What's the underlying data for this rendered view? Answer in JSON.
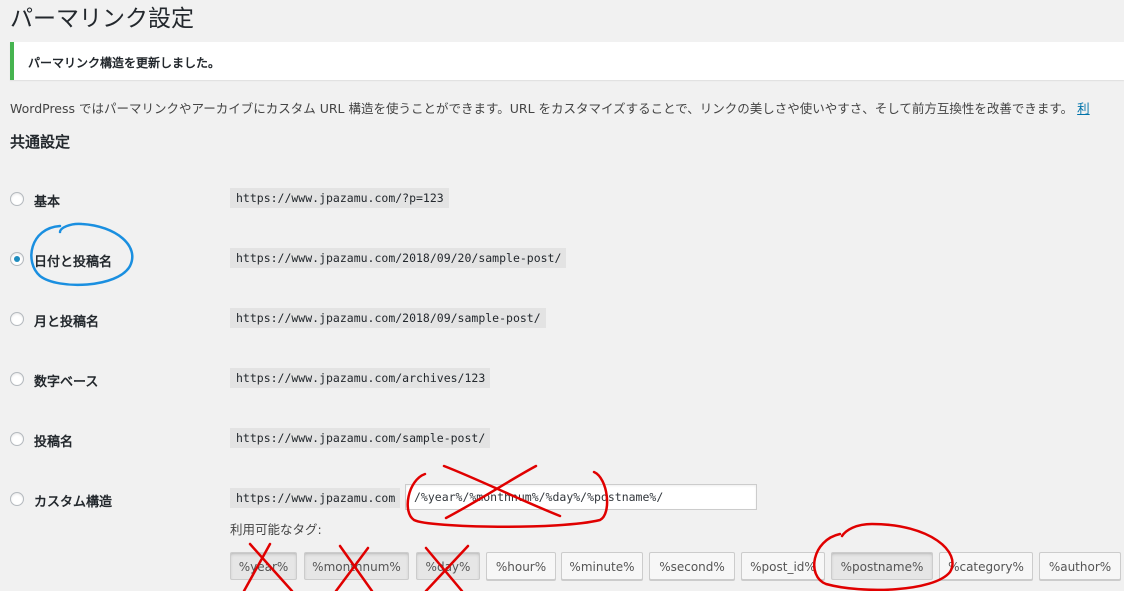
{
  "page": {
    "title": "パーマリンク設定",
    "notice": "パーマリンク構造を更新しました。",
    "intro_text": "WordPress ではパーマリンクやアーカイブにカスタム URL 構造を使うことができます。URL をカスタマイズすることで、リンクの美しさや使いやすさ、そして前方互換性を改善できます。",
    "intro_link": "利",
    "section_title": "共通設定"
  },
  "options": [
    {
      "label": "基本",
      "example": "https://www.jpazamu.com/?p=123",
      "checked": false
    },
    {
      "label": "日付と投稿名",
      "example": "https://www.jpazamu.com/2018/09/20/sample-post/",
      "checked": true
    },
    {
      "label": "月と投稿名",
      "example": "https://www.jpazamu.com/2018/09/sample-post/",
      "checked": false
    },
    {
      "label": "数字ベース",
      "example": "https://www.jpazamu.com/archives/123",
      "checked": false
    },
    {
      "label": "投稿名",
      "example": "https://www.jpazamu.com/sample-post/",
      "checked": false
    },
    {
      "label": "カスタム構造",
      "example": "https://www.jpazamu.com",
      "checked": false
    }
  ],
  "custom_structure": {
    "value": "/%year%/%monthnum%/%day%/%postname%/"
  },
  "tags": {
    "label": "利用可能なタグ:",
    "items": [
      "%year%",
      "%monthnum%",
      "%day%",
      "%hour%",
      "%minute%",
      "%second%",
      "%post_id%",
      "%postname%",
      "%category%",
      "%author%"
    ]
  },
  "colors": {
    "accent": "#1e8cbe",
    "notice_border": "#46b450",
    "annotation_blue": "#1a8fe0",
    "annotation_red": "#e00000"
  }
}
